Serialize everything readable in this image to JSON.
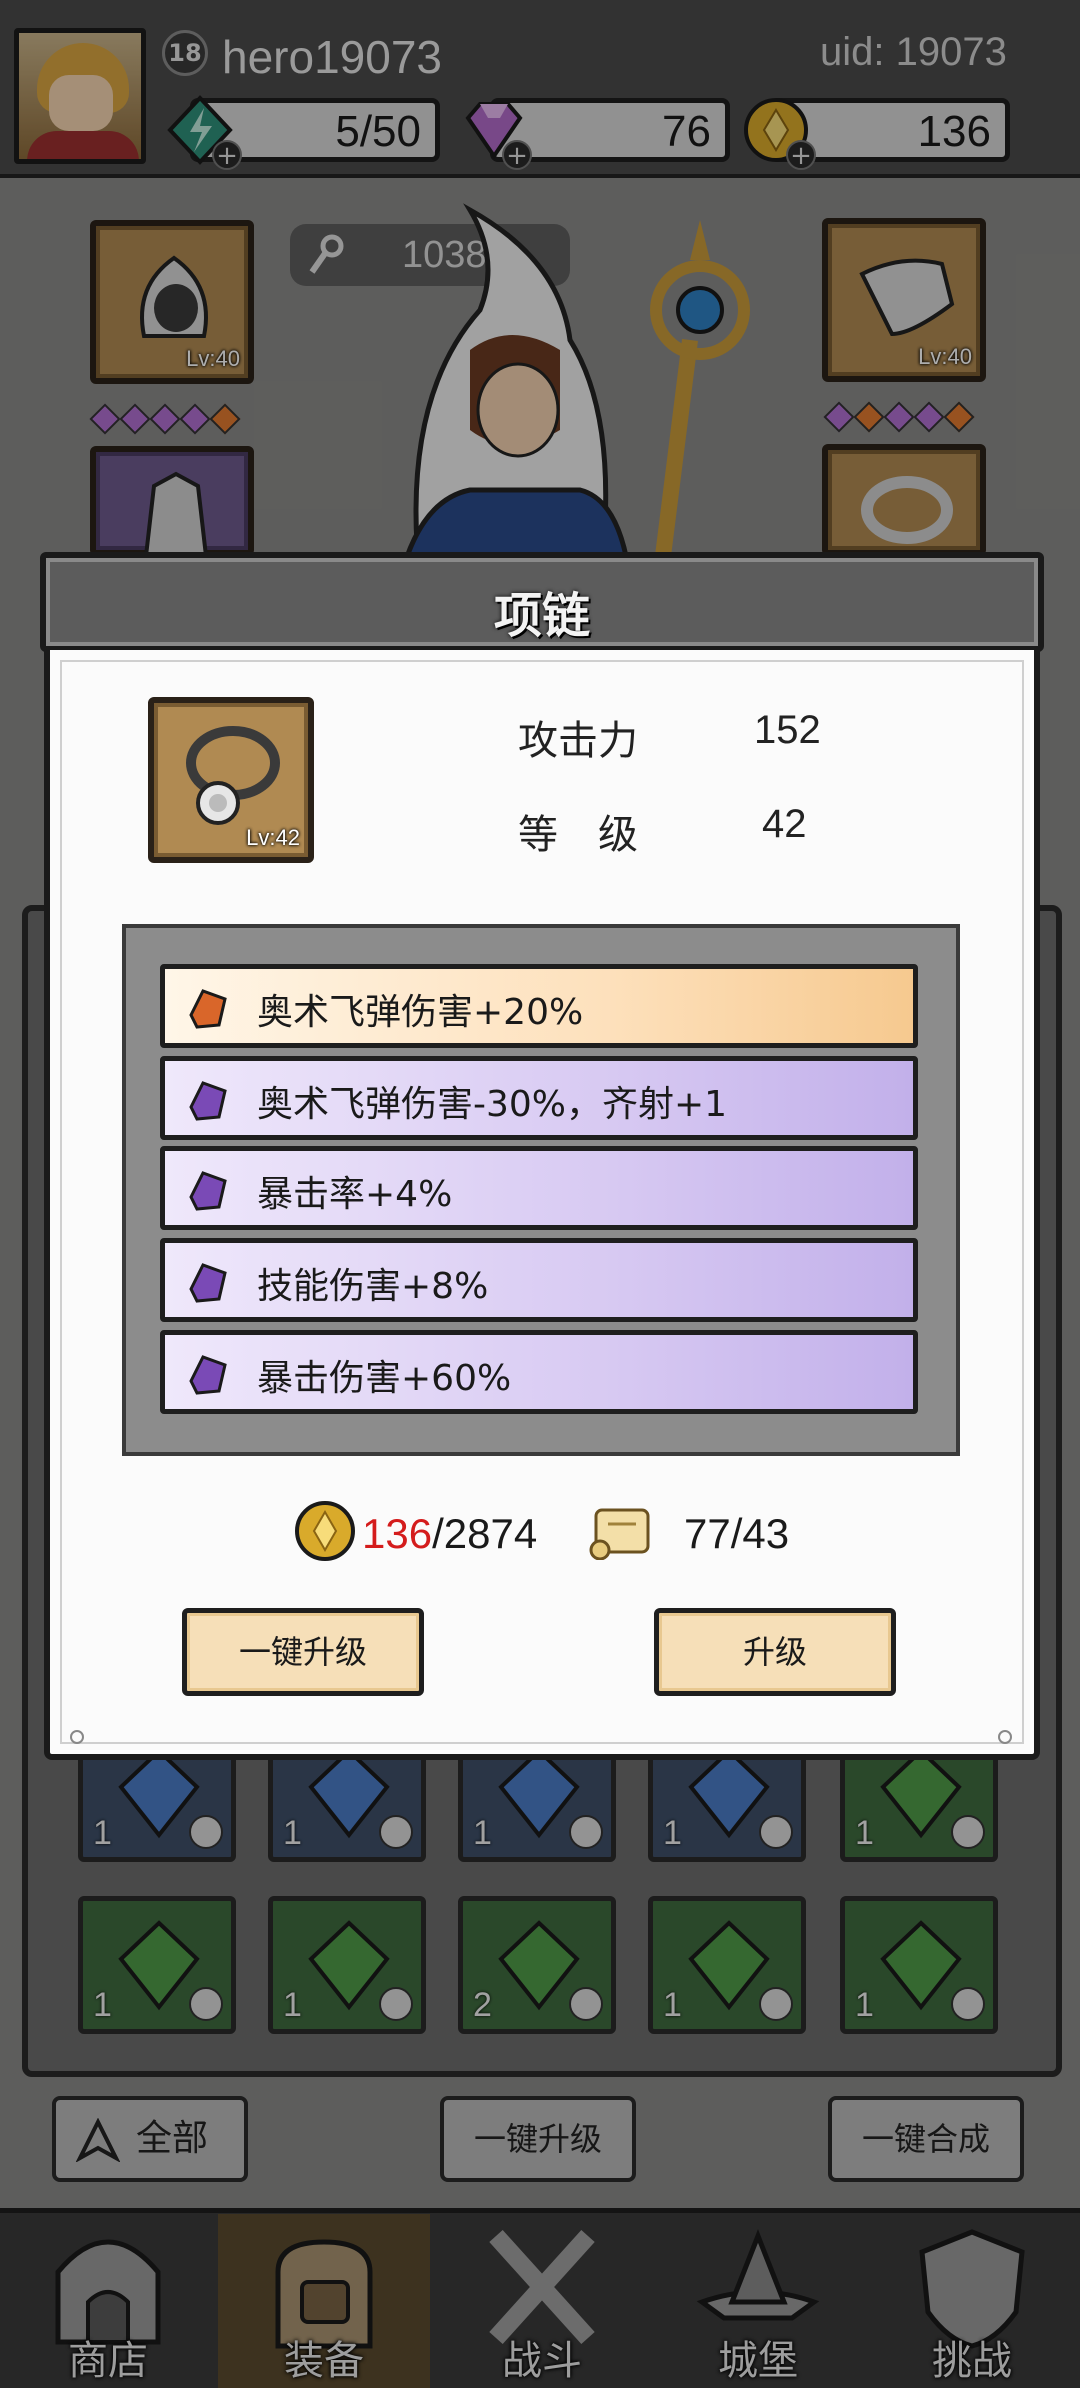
{
  "player": {
    "level": "18",
    "name": "hero19073",
    "uid": "uid: 19073"
  },
  "resources": {
    "energy": "5/50",
    "gems": "76",
    "gold": "136"
  },
  "equipment": {
    "power": "1038",
    "left_top_level": "Lv:40",
    "right_top_level": "Lv:40"
  },
  "dialog": {
    "title": "项链",
    "item_level": "Lv:42",
    "stats": [
      {
        "label": "攻击力",
        "value": "152"
      },
      {
        "label": "等　级",
        "value": "42"
      }
    ],
    "affixes": [
      {
        "text": "奥术飞弹伤害+20%",
        "rarity": "orange"
      },
      {
        "text": "奥术飞弹伤害-30%，齐射+1",
        "rarity": "purple"
      },
      {
        "text": "暴击率+4%",
        "rarity": "purple"
      },
      {
        "text": "技能伤害+8%",
        "rarity": "purple"
      },
      {
        "text": "暴击伤害+60%",
        "rarity": "purple"
      }
    ],
    "cost": {
      "gold_have": "136",
      "gold_need": "/2874",
      "scroll": "77/43"
    },
    "buttons": {
      "upgrade_all": "一键升级",
      "upgrade": "升级"
    }
  },
  "inventory": {
    "row1_counts": [
      "1",
      "1",
      "1",
      "1",
      "1"
    ],
    "row2_counts": [
      "1",
      "1",
      "2",
      "1",
      "1"
    ]
  },
  "toolbar": {
    "filter": "全部",
    "upgrade_all": "一键升级",
    "merge_all": "一键合成"
  },
  "tabs": [
    "商店",
    "装备",
    "战斗",
    "城堡",
    "挑战"
  ],
  "colors": {
    "accent_red": "#d41c1c",
    "orange_affix": "#f6c98f",
    "purple_affix": "#c2b0ea"
  }
}
